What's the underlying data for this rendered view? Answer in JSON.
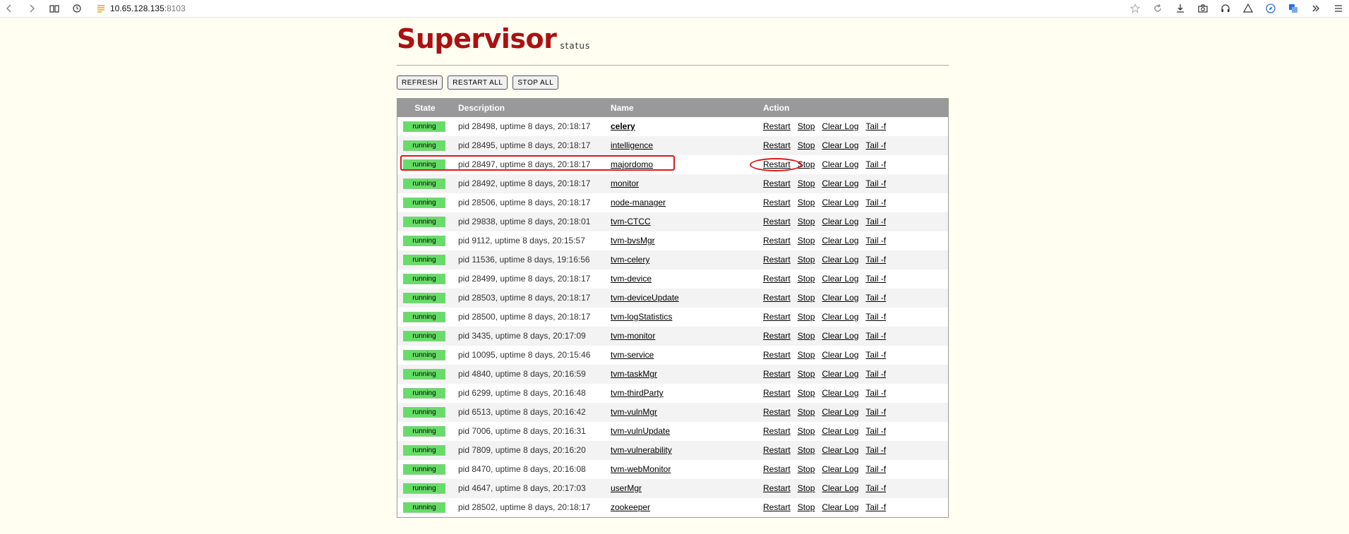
{
  "browser": {
    "url_host": "10.65.128.135",
    "url_port": ":8103"
  },
  "header": {
    "logo_main": "Supervisor",
    "logo_sub": "status"
  },
  "buttons": {
    "refresh": "REFRESH",
    "restart_all": "RESTART ALL",
    "stop_all": "STOP ALL"
  },
  "table": {
    "headers": {
      "state": "State",
      "description": "Description",
      "name": "Name",
      "action": "Action"
    },
    "actions": {
      "restart": "Restart",
      "stop": "Stop",
      "clear_log": "Clear Log",
      "tail": "Tail -f"
    },
    "rows": [
      {
        "state": "running",
        "description": "pid 28498, uptime 8 days, 20:18:17",
        "name": "celery"
      },
      {
        "state": "running",
        "description": "pid 28495, uptime 8 days, 20:18:17",
        "name": "intelligence"
      },
      {
        "state": "running",
        "description": "pid 28497, uptime 8 days, 20:18:17",
        "name": "majordomo"
      },
      {
        "state": "running",
        "description": "pid 28492, uptime 8 days, 20:18:17",
        "name": "monitor"
      },
      {
        "state": "running",
        "description": "pid 28506, uptime 8 days, 20:18:17",
        "name": "node-manager"
      },
      {
        "state": "running",
        "description": "pid 29838, uptime 8 days, 20:18:01",
        "name": "tvm-CTCC"
      },
      {
        "state": "running",
        "description": "pid 9112, uptime 8 days, 20:15:57",
        "name": "tvm-bvsMgr"
      },
      {
        "state": "running",
        "description": "pid 11536, uptime 8 days, 19:16:56",
        "name": "tvm-celery"
      },
      {
        "state": "running",
        "description": "pid 28499, uptime 8 days, 20:18:17",
        "name": "tvm-device"
      },
      {
        "state": "running",
        "description": "pid 28503, uptime 8 days, 20:18:17",
        "name": "tvm-deviceUpdate"
      },
      {
        "state": "running",
        "description": "pid 28500, uptime 8 days, 20:18:17",
        "name": "tvm-logStatistics"
      },
      {
        "state": "running",
        "description": "pid 3435, uptime 8 days, 20:17:09",
        "name": "tvm-monitor"
      },
      {
        "state": "running",
        "description": "pid 10095, uptime 8 days, 20:15:46",
        "name": "tvm-service"
      },
      {
        "state": "running",
        "description": "pid 4840, uptime 8 days, 20:16:59",
        "name": "tvm-taskMgr"
      },
      {
        "state": "running",
        "description": "pid 6299, uptime 8 days, 20:16:48",
        "name": "tvm-thirdParty"
      },
      {
        "state": "running",
        "description": "pid 6513, uptime 8 days, 20:16:42",
        "name": "tvm-vulnMgr"
      },
      {
        "state": "running",
        "description": "pid 7006, uptime 8 days, 20:16:31",
        "name": "tvm-vulnUpdate"
      },
      {
        "state": "running",
        "description": "pid 7809, uptime 8 days, 20:16:20",
        "name": "tvm-vulnerability"
      },
      {
        "state": "running",
        "description": "pid 8470, uptime 8 days, 20:16:08",
        "name": "tvm-webMonitor"
      },
      {
        "state": "running",
        "description": "pid 4647, uptime 8 days, 20:17:03",
        "name": "userMgr"
      },
      {
        "state": "running",
        "description": "pid 28502, uptime 8 days, 20:18:17",
        "name": "zookeeper"
      }
    ]
  },
  "colors": {
    "page_bg": "#fffef1",
    "logo_red": "#aa1111",
    "header_gray": "#999999",
    "running_green": "#66dd66",
    "annotation_red": "#e01818"
  }
}
